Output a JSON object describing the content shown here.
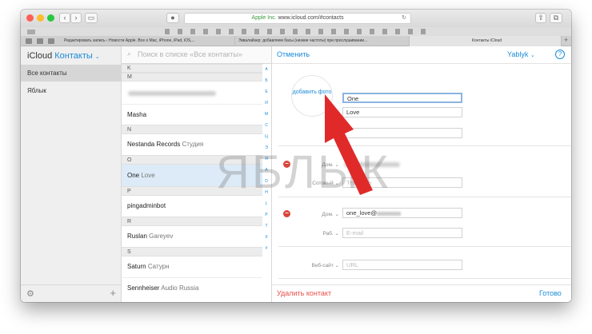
{
  "browser": {
    "address": "Apple Inc. www.icloud.com/#contacts",
    "address_secure": "Apple Inc.",
    "address_url": "www.icloud.com/#contacts"
  },
  "tabs": [
    {
      "label": "Редактировать запись ‹ Новости Apple. Все о Mac, iPhone, iPad, iOS,..."
    },
    {
      "label": "Эквалайзер: добавляем басы (низкие частоты) при прослушивании..."
    },
    {
      "label": "Контакты iCloud"
    }
  ],
  "sidebar": {
    "app_name": "iCloud",
    "section": "Контакты",
    "items": [
      {
        "label": "Все контакты"
      },
      {
        "label": "Яблык"
      }
    ]
  },
  "list": {
    "search_placeholder": "Поиск в списке «Все контакты»",
    "rows": [
      {
        "type": "header",
        "label": "K"
      },
      {
        "type": "header",
        "label": "M"
      },
      {
        "type": "contact",
        "first": "Masha",
        "last": ""
      },
      {
        "type": "header",
        "label": "N"
      },
      {
        "type": "contact",
        "first": "Nestanda Records",
        "last": "Студия"
      },
      {
        "type": "header",
        "label": "O"
      },
      {
        "type": "contact",
        "first": "One",
        "last": "Love"
      },
      {
        "type": "header",
        "label": "P"
      },
      {
        "type": "contact",
        "first": "pingadminbot",
        "last": ""
      },
      {
        "type": "header",
        "label": "R"
      },
      {
        "type": "contact",
        "first": "Ruslan",
        "last": "Gareyev"
      },
      {
        "type": "header",
        "label": "S"
      },
      {
        "type": "contact",
        "first": "Saturn",
        "last": "Сатурн"
      },
      {
        "type": "contact",
        "first": "Sennheiser",
        "last": "Audio Russia"
      }
    ],
    "index_letters": [
      "A",
      "Б",
      "Е",
      "И",
      "М",
      "С",
      "Ц",
      "Э",
      "Я",
      "A",
      "D",
      "H",
      "L",
      "P",
      "T",
      "X",
      "#"
    ]
  },
  "detail": {
    "cancel": "Отменить",
    "account": "Yablyk",
    "help": "?",
    "add_photo": "добавить фото",
    "first_name": "One",
    "last_name": "Love",
    "phone_label_home": "Дом.",
    "phone_label_mobile": "Сотовый",
    "phone_placeholder": "Телефон",
    "email_label_home": "Дом.",
    "email_value": "one_love@",
    "email_label_work": "Раб.",
    "email_placeholder": "E-mail",
    "website_label": "Веб-сайт",
    "website_placeholder": "URL",
    "delete": "Удалить контакт",
    "done": "Готово"
  },
  "watermark": "ЯБЛЫК",
  "colors": {
    "accent": "#1a8bd8",
    "delete": "#e8504a",
    "arrow": "#e02a2a"
  }
}
